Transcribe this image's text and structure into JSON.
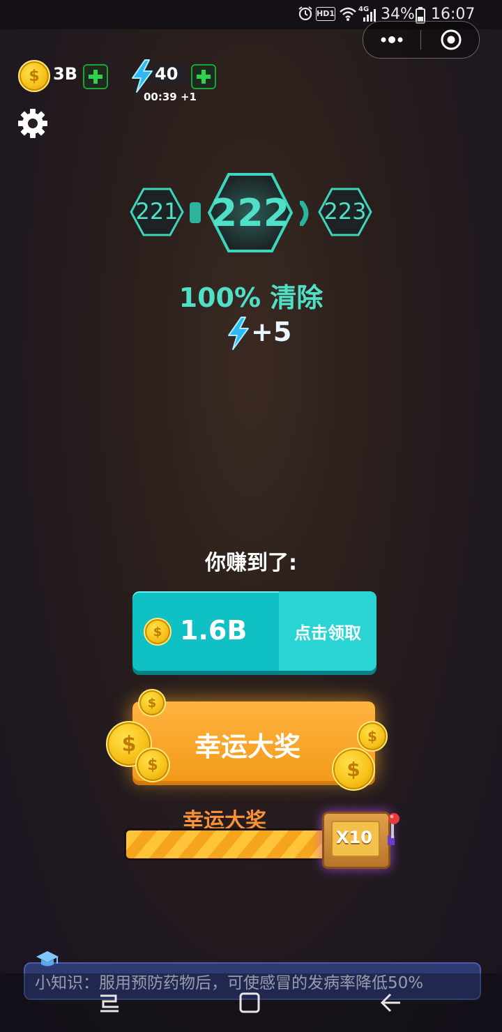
{
  "status_bar": {
    "battery": "34%",
    "time": "16:07",
    "hd_label": "HD1",
    "network": "4G",
    "icons": [
      "alarm-icon",
      "hd-icon",
      "wifi-icon",
      "signal-icon",
      "battery-icon"
    ]
  },
  "capsule": {
    "more_icon": "more-dots-icon",
    "close_icon": "target-icon"
  },
  "top_bar": {
    "coins": "3B",
    "energy": "40",
    "energy_timer": "00:39 +1"
  },
  "levels": {
    "prev": "221",
    "current": "222",
    "next": "223"
  },
  "result": {
    "clear_text": "100% 清除",
    "energy_reward": "+5"
  },
  "earned": {
    "label": "你赚到了:",
    "amount": "1.6B",
    "claim_label": "点击领取"
  },
  "lucky": {
    "button_label": "幸运大奖",
    "bar_title": "幸运大奖",
    "multiplier": "X10",
    "progress": 0.95
  },
  "tip": {
    "text": "小知识：服用预防药物后，可使感冒的发病率降低50%"
  },
  "colors": {
    "teal": "#4fe0c7",
    "claim": "#0fc0c4",
    "lucky": "#f7a526",
    "coin": "#f7c21a"
  }
}
